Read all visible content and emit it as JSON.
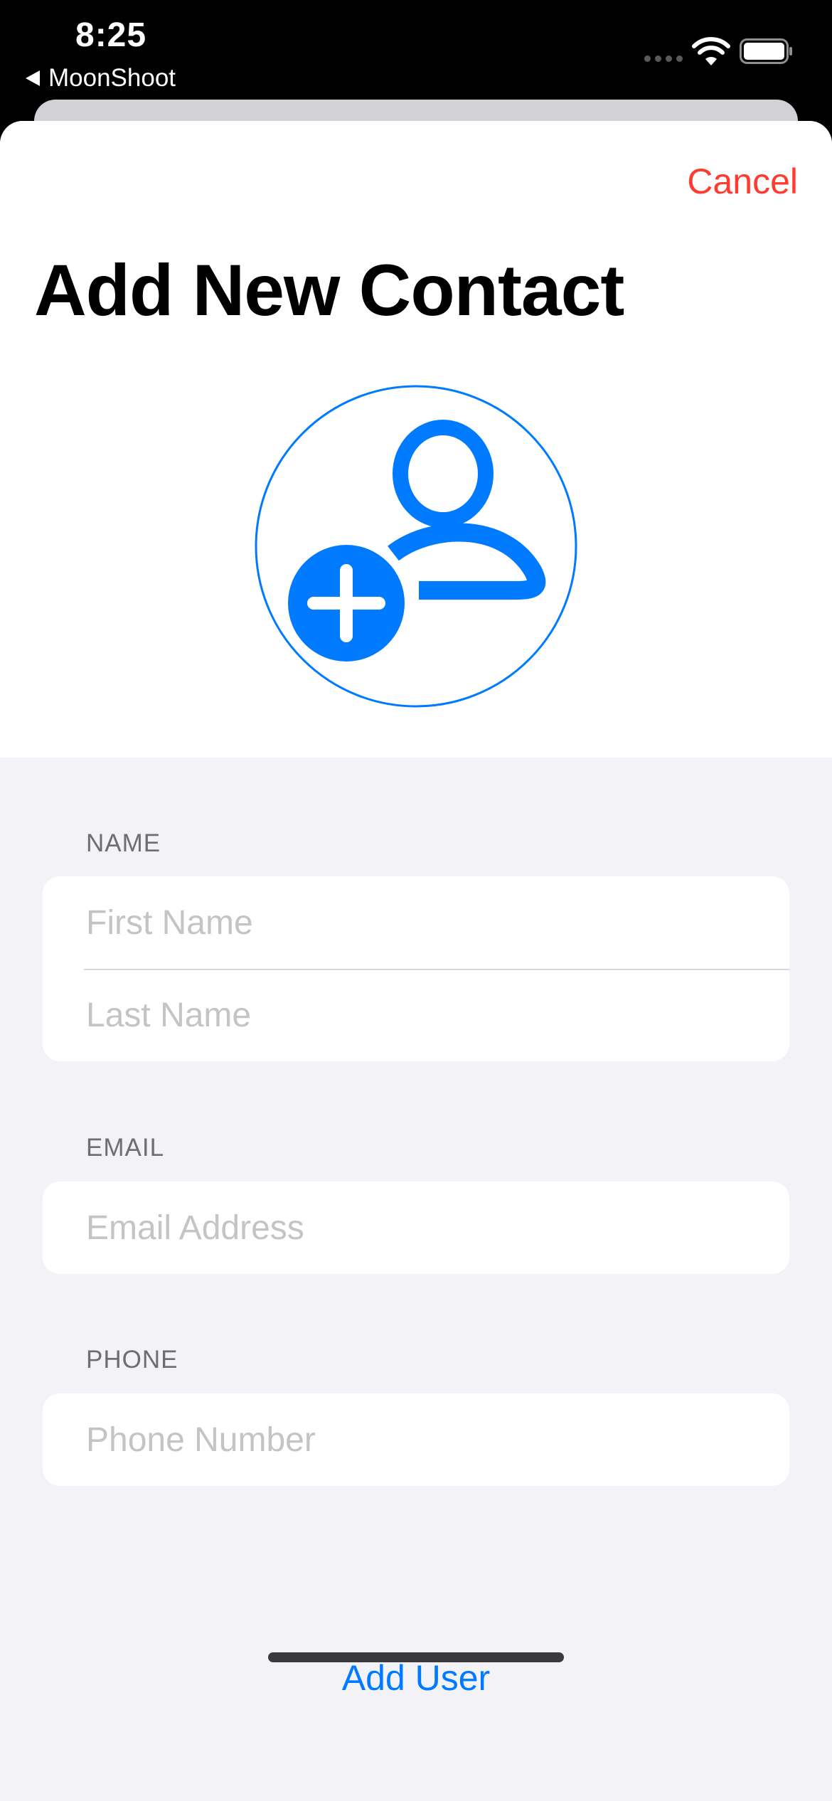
{
  "status_bar": {
    "time": "8:25",
    "back_label": "MoonShoot"
  },
  "sheet": {
    "cancel_label": "Cancel",
    "title": "Add New Contact"
  },
  "avatar": {
    "icon": "person-badge-plus-icon",
    "accent_color": "#007aff"
  },
  "sections": {
    "name": {
      "header": "NAME",
      "first_name_placeholder": "First Name",
      "last_name_placeholder": "Last Name"
    },
    "email": {
      "header": "EMAIL",
      "placeholder": "Email Address"
    },
    "phone": {
      "header": "PHONE",
      "placeholder": "Phone Number"
    }
  },
  "actions": {
    "add_user_label": "Add User"
  },
  "colors": {
    "accent": "#007aff",
    "destructive": "#ff3b30",
    "grouped_background": "#f2f2f7"
  }
}
